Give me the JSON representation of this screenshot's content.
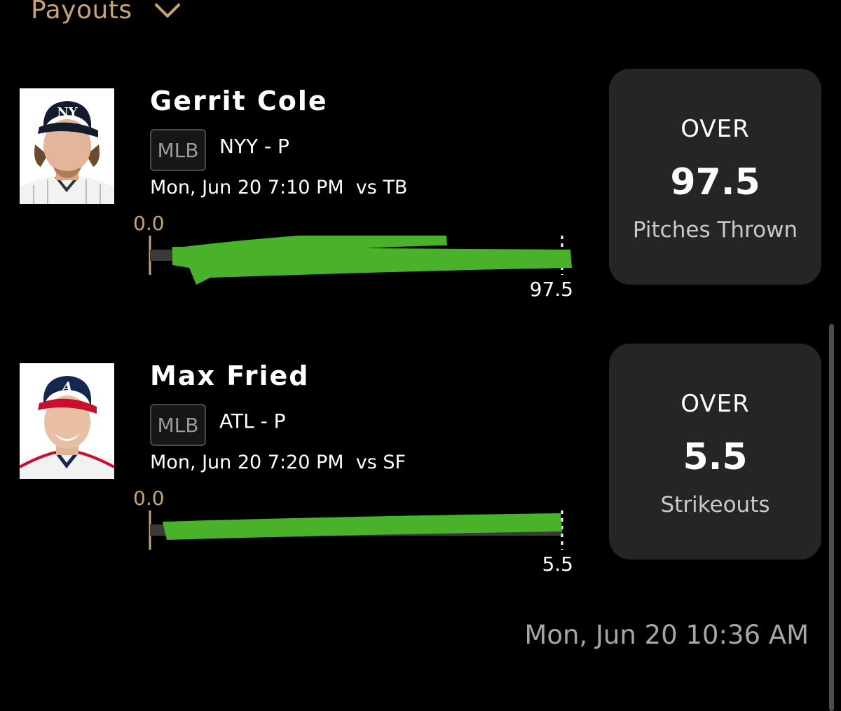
{
  "header": {
    "title": "Payouts",
    "chevron_icon": "chevron-down-icon"
  },
  "accent_colors": {
    "gold": "#c8a46e",
    "marker_green": "#4ab22a",
    "card_bg": "#252525"
  },
  "picks": [
    {
      "player_name": "Gerrit Cole",
      "avatar_icon": "player-headshot-yankees",
      "league": "MLB",
      "team_position": "NYY - P",
      "game_time": "Mon, Jun 20 7:10 PM  vs TB",
      "progress_start": "0.0",
      "progress_target": "97.5",
      "direction": "OVER",
      "line": "97.5",
      "stat": "Pitches Thrown"
    },
    {
      "player_name": "Max Fried",
      "avatar_icon": "player-headshot-braves",
      "league": "MLB",
      "team_position": "ATL - P",
      "game_time": "Mon, Jun 20 7:20 PM  vs SF",
      "progress_start": "0.0",
      "progress_target": "5.5",
      "direction": "OVER",
      "line": "5.5",
      "stat": "Strikeouts"
    }
  ],
  "timestamp": "Mon, Jun 20 10:36 AM"
}
